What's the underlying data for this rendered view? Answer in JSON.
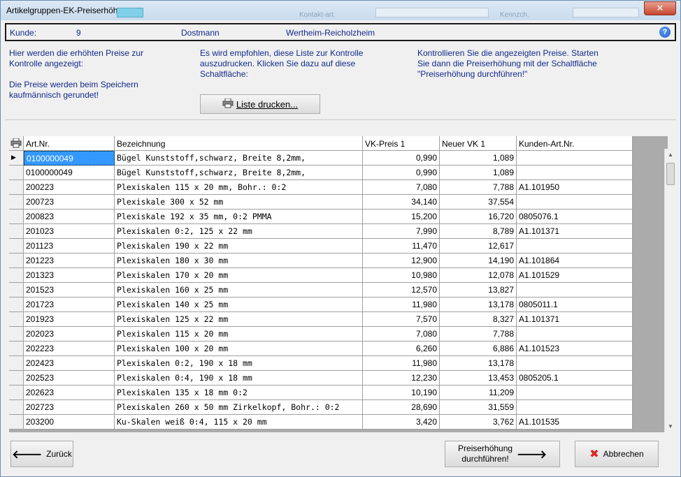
{
  "window": {
    "title": "Artikelgruppen-EK-Preiserhöhung"
  },
  "background_labels": {
    "kontakt": "Kontakt-art:",
    "kennz": "Kennzch."
  },
  "customer": {
    "label": "Kunde:",
    "number": "9",
    "name": "Dostmann",
    "city": "Wertheim-Reicholzheim"
  },
  "info": {
    "col1": [
      "Hier werden die erhöhten Preise zur",
      "Kontrolle angezeigt:",
      "",
      "Die Preise werden beim Speichern",
      "kaufmännisch gerundet!"
    ],
    "col2": [
      "Es wird empfohlen, diese Liste zur Kontrolle",
      "auszudrucken. Klicken Sie dazu auf diese",
      "Schaltfläche:"
    ],
    "col3": [
      "Kontrollieren Sie die angezeigten Preise. Starten",
      "Sie dann die Preiserhöhung mit der Schaltfläche",
      "\"Preiserhöhung durchführen!\""
    ]
  },
  "print_button": {
    "label": "Liste drucken..."
  },
  "table": {
    "headers": [
      "Art.Nr.",
      "Bezeichnung",
      "VK-Preis 1",
      "Neuer VK 1",
      "Kunden-Art.Nr."
    ],
    "rows": [
      [
        "0100000049",
        "Bügel Kunststoff,schwarz, Breite 8,2mm,",
        "0,990",
        "1,089",
        ""
      ],
      [
        "0100000049",
        "Bügel Kunststoff,schwarz, Breite 8,2mm,",
        "0,990",
        "1,089",
        ""
      ],
      [
        "200223",
        "Plexiskalen 115 x 20 mm, Bohr.: 0:2",
        "7,080",
        "7,788",
        "A1.101950"
      ],
      [
        "200723",
        "Plexiskale 300 x 52 mm",
        "34,140",
        "37,554",
        ""
      ],
      [
        "200823",
        "Plexiskale 192 x 35 mm, 0:2 PMMA",
        "15,200",
        "16,720",
        "0805076.1"
      ],
      [
        "201023",
        "Plexiskalen 0:2, 125 x 22 mm",
        "7,990",
        "8,789",
        "A1.101371"
      ],
      [
        "201123",
        "Plexiskalen 190 x 22 mm",
        "11,470",
        "12,617",
        ""
      ],
      [
        "201223",
        "Plexiskalen 180 x 30 mm",
        "12,900",
        "14,190",
        "A1.101864"
      ],
      [
        "201323",
        "Plexiskalen 170 x 20 mm",
        "10,980",
        "12,078",
        "A1.101529"
      ],
      [
        "201523",
        "Plexiskalen 160 x 25 mm",
        "12,570",
        "13,827",
        ""
      ],
      [
        "201723",
        "Plexiskalen 140 x 25 mm",
        "11,980",
        "13,178",
        "0805011.1"
      ],
      [
        "201923",
        "Plexiskalen 125 x 22 mm",
        "7,570",
        "8,327",
        "A1.101371"
      ],
      [
        "202023",
        "Plexiskalen 115 x 20 mm",
        "7,080",
        "7,788",
        ""
      ],
      [
        "202223",
        "Plexiskalen 100 x 20 mm",
        "6,260",
        "6,886",
        "A1.101523"
      ],
      [
        "202423",
        "Plexiskalen 0:2, 190 x 18 mm",
        "11,980",
        "13,178",
        ""
      ],
      [
        "202523",
        "Plexiskalen 0:4, 190 x 18 mm",
        "12,230",
        "13,453",
        "0805205.1"
      ],
      [
        "202623",
        "Plexiskalen 135 x 18 mm 0:2",
        "10,190",
        "11,209",
        ""
      ],
      [
        "202723",
        "Plexiskalen 260 x 50 mm Zirkelkopf, Bohr.: 0:2",
        "28,690",
        "31,559",
        ""
      ],
      [
        "203200",
        "Ku-Skalen weiß 0:4, 115 x 20 mm",
        "3,420",
        "3,762",
        "A1.101535"
      ]
    ]
  },
  "footer": {
    "back": "Zurück",
    "execute_line1": "Preiserhöhung",
    "execute_line2": "durchführen!",
    "cancel": "Abbrechen"
  },
  "icons": {
    "close": "close-icon",
    "help": "help-icon",
    "printer": "printer-icon"
  },
  "colors": {
    "info_text": "#102a8a",
    "selection": "#3399ff",
    "close_button": "#c7452f"
  }
}
